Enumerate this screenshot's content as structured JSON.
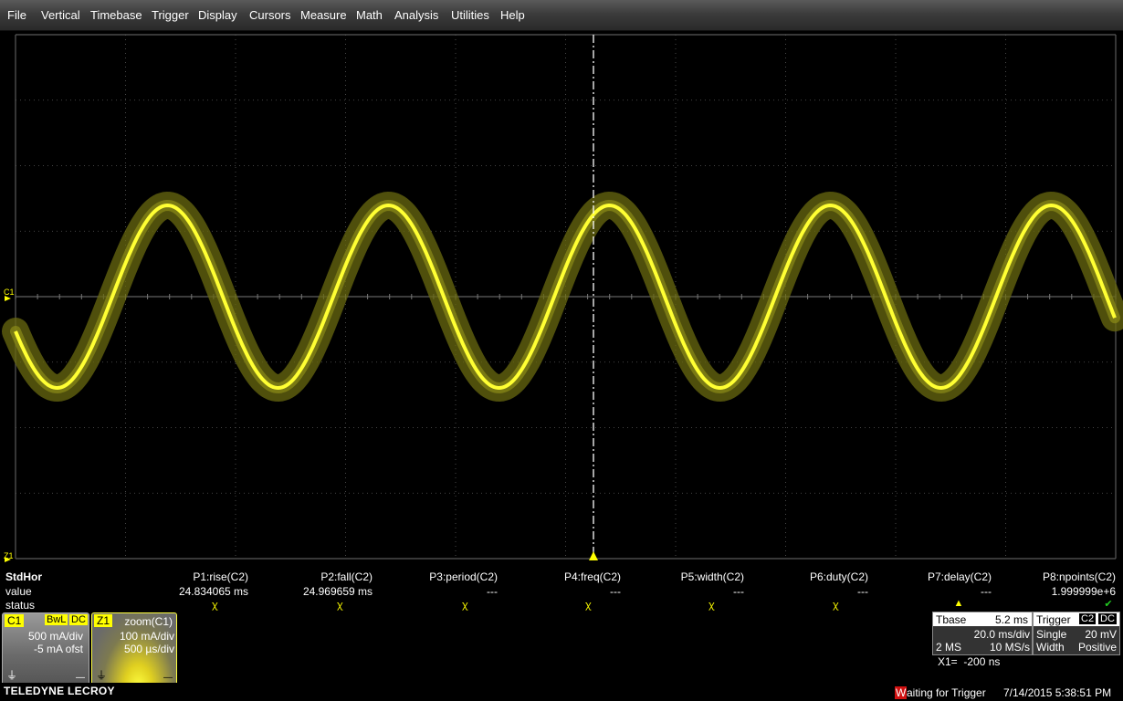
{
  "menu": [
    "File",
    "Vertical",
    "Timebase",
    "Trigger",
    "Display",
    "Cursors",
    "Measure",
    "Math",
    "Analysis",
    "Utilities",
    "Help"
  ],
  "markers": {
    "c1": "C1",
    "z1": "Z1"
  },
  "colors": {
    "trace": "#ffff33",
    "trace_glow": "#6a6a10",
    "grid": "#5a5a5a",
    "c1_tag": "#ffff00",
    "z1_tag": "#ffff00"
  },
  "measure": {
    "row_labels": {
      "title": "StdHor",
      "value": "value",
      "status": "status"
    },
    "params": [
      {
        "name": "P1:rise(C2)",
        "value": "24.834065 ms",
        "status": "mark"
      },
      {
        "name": "P2:fall(C2)",
        "value": "24.969659 ms",
        "status": "mark"
      },
      {
        "name": "P3:period(C2)",
        "value": "---",
        "status": "mark"
      },
      {
        "name": "P4:freq(C2)",
        "value": "---",
        "status": "mark"
      },
      {
        "name": "P5:width(C2)",
        "value": "---",
        "status": "mark"
      },
      {
        "name": "P6:duty(C2)",
        "value": "---",
        "status": "mark"
      },
      {
        "name": "P7:delay(C2)",
        "value": "---",
        "status": "warning"
      },
      {
        "name": "P8:npoints(C2)",
        "value": "1.999999e+6",
        "status": "check"
      }
    ],
    "status_glyphs": {
      "mark": "ꭓ",
      "warning": "▲",
      "check": "✔"
    }
  },
  "c1_box": {
    "tag": "C1",
    "bwl": "BwL",
    "dc": "DC",
    "vdiv": "500 mA/div",
    "offset": "-5 mA ofst"
  },
  "z1_box": {
    "tag": "Z1",
    "label": "zoom(C1)",
    "vdiv": "100 mA/div",
    "tdiv": "500 µs/div"
  },
  "timebase": {
    "label": "Tbase",
    "delay": "5.2 ms",
    "tdiv": "20.0 ms/div",
    "samples": "2 MS",
    "rate": "10 MS/s"
  },
  "trigger": {
    "label": "Trigger",
    "source": "C2",
    "coupling": "DC",
    "mode": "Single",
    "level": "20 mV",
    "type": "Width",
    "slope": "Positive"
  },
  "cursor": {
    "readout": "X1=  -200 ns"
  },
  "footer": {
    "brand": "TELEDYNE LECROY",
    "status_first": "W",
    "status_rest": "aiting for Trigger",
    "datetime": "7/14/2015 5:38:51 PM"
  }
}
